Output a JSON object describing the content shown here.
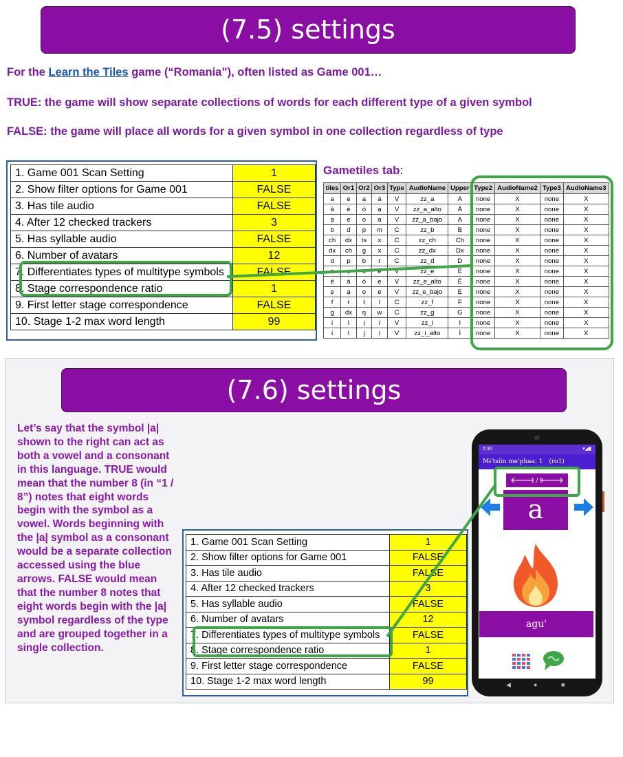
{
  "top": {
    "banner_title": "(7.5) settings",
    "intro_prefix": "For the ",
    "intro_link": "Learn the Tiles",
    "intro_suffix": " game (“Romania”), often listed as Game 001…",
    "true_line": "TRUE: the game will show separate collections of words for each different type of a given symbol",
    "false_line": "FALSE: the game will place all words for a given symbol in one collection regardless of type"
  },
  "settings_rows": [
    {
      "label": "1. Game 001 Scan Setting",
      "value": "1"
    },
    {
      "label": "2. Show filter options for Game 001",
      "value": "FALSE"
    },
    {
      "label": "3. Has tile audio",
      "value": "FALSE"
    },
    {
      "label": "4. After 12 checked trackers",
      "value": "3"
    },
    {
      "label": "5. Has syllable audio",
      "value": "FALSE"
    },
    {
      "label": "6. Number of avatars",
      "value": "12"
    },
    {
      "label": "7. Differentiates types of multitype symbols",
      "value": "FALSE"
    },
    {
      "label": "8. Stage correspondence ratio",
      "value": "1"
    },
    {
      "label": "9. First letter stage correspondence",
      "value": "FALSE"
    },
    {
      "label": "10. Stage 1-2 max word length",
      "value": "99"
    }
  ],
  "gametiles": {
    "title": "Gametiles tab",
    "title_suffix": ":",
    "headers": [
      "tiles",
      "Or1",
      "Or2",
      "Or3",
      "Type",
      "AudioName",
      "Upper",
      "Type2",
      "AudioName2",
      "Type3",
      "AudioName3"
    ],
    "rows": [
      [
        "a",
        "e",
        "ạ",
        "á",
        "V",
        "zz_a",
        "A",
        "none",
        "X",
        "none",
        "X"
      ],
      [
        "á",
        "é",
        "ó",
        "ạ",
        "V",
        "zz_a_alto",
        "Á",
        "none",
        "X",
        "none",
        "X"
      ],
      [
        "ạ",
        "ẹ",
        "ọ",
        "a",
        "V",
        "zz_a_bajo",
        "Ạ",
        "none",
        "X",
        "none",
        "X"
      ],
      [
        "b",
        "d",
        "p",
        "m",
        "C",
        "zz_b",
        "B",
        "none",
        "X",
        "none",
        "X"
      ],
      [
        "ch",
        "dx",
        "ts",
        "x",
        "C",
        "zz_ch",
        "Ch",
        "none",
        "X",
        "none",
        "X"
      ],
      [
        "dx",
        "ch",
        "g",
        "x",
        "C",
        "zz_dx",
        "Dx",
        "none",
        "X",
        "none",
        "X"
      ],
      [
        "d",
        "p",
        "b",
        "r",
        "C",
        "zz_d",
        "D",
        "none",
        "X",
        "none",
        "X"
      ],
      [
        "e",
        "ẹ",
        "o",
        "é",
        "V",
        "zz_e",
        "E",
        "none",
        "X",
        "none",
        "X"
      ],
      [
        "é",
        "á",
        "ó",
        "ẹ",
        "V",
        "zz_e_alto",
        "É",
        "none",
        "X",
        "none",
        "X"
      ],
      [
        "ẹ",
        "ạ",
        "ọ",
        "e",
        "V",
        "zz_e_bajo",
        "Ẹ",
        "none",
        "X",
        "none",
        "X"
      ],
      [
        "f",
        "r",
        "t",
        "l",
        "C",
        "zz_f",
        "F",
        "none",
        "X",
        "none",
        "X"
      ],
      [
        "g",
        "dx",
        "ŋ",
        "w",
        "C",
        "zz_g",
        "G",
        "none",
        "X",
        "none",
        "X"
      ],
      [
        "i",
        "l",
        "ị",
        "í",
        "V",
        "zz_i",
        "I",
        "none",
        "X",
        "none",
        "X"
      ],
      [
        "í",
        "l",
        "j",
        "ị",
        "V",
        "zz_i_alto",
        "Í",
        "none",
        "X",
        "none",
        "X"
      ]
    ]
  },
  "bottom": {
    "banner_title": "(7.6) settings",
    "paragraph": "Let’s say that the symbol |a| shown to the right can act as both a vowel and a consonant in this language. TRUE would mean that the number 8 (in “1 / 8”) notes that eight words begin with the symbol as a vowel. Words beginning with the |a| symbol as a consonant would be a separate collection accessed using the blue arrows. FALSE would mean that the number 8 notes that eight words begin with the |a| symbol regardless of the type and are grouped together in a single collection."
  },
  "phone": {
    "status_time": "5:30",
    "app_title": "Mɨˈtsíin meˈphaa: 1",
    "app_code": "(ro1)",
    "counter": "1 / 8",
    "tile": "a",
    "word": "agu'"
  },
  "colors": {
    "banner": "#8a0ea3",
    "highlight_green": "#3fa548",
    "yellow_cell": "#ffff00",
    "table_frame_blue": "#2b5fad",
    "arrow_blue": "#1e7de6"
  },
  "icons": [
    "left-arrow-icon",
    "right-arrow-icon",
    "fire-icon",
    "tile-grid-icon",
    "speech-bubble-icon",
    "back-nav-icon",
    "home-nav-icon",
    "recents-nav-icon"
  ]
}
